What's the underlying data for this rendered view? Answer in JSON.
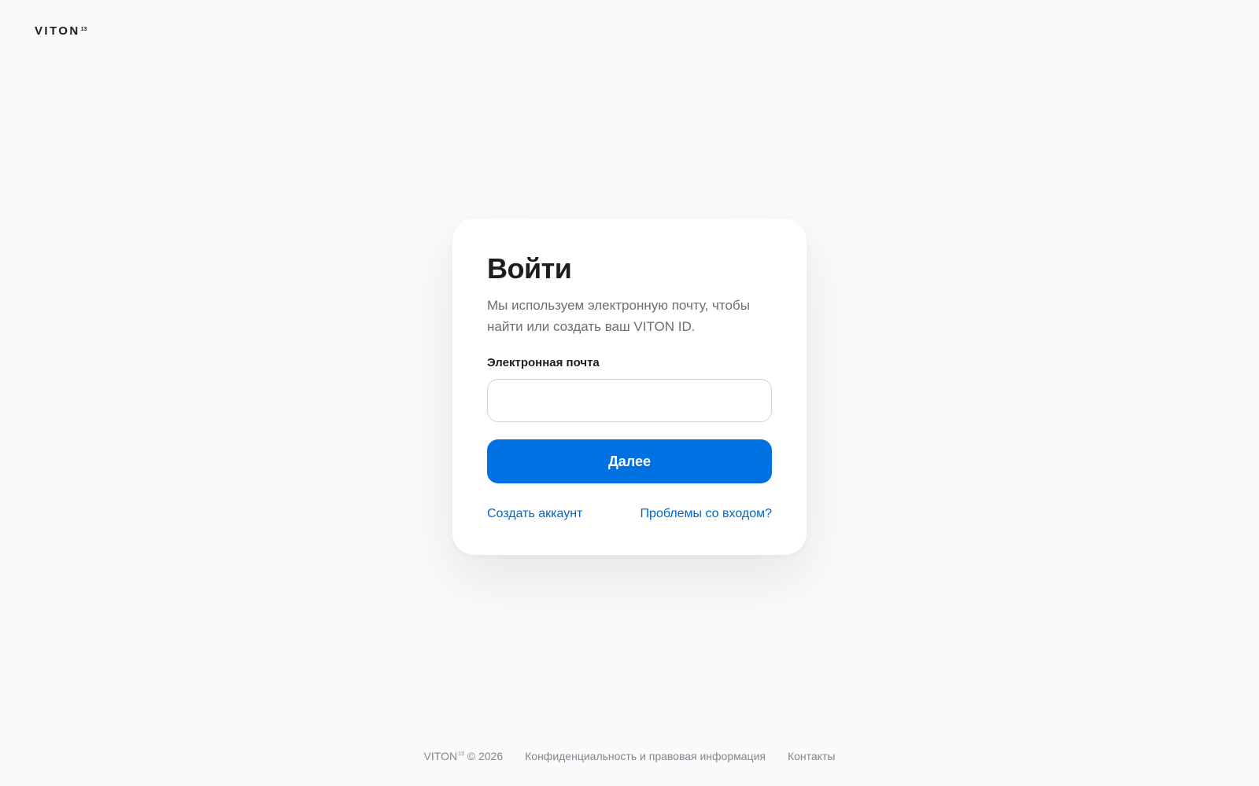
{
  "header": {
    "logo_text": "VITON",
    "logo_sup": "13"
  },
  "signin": {
    "title": "Войти",
    "subtitle": "Мы используем электронную почту, чтобы найти или создать ваш VITON ID.",
    "email_label": "Электронная почта",
    "email_value": "",
    "email_placeholder": "",
    "next_button": "Далее",
    "create_account_link": "Создать аккаунт",
    "trouble_link": "Проблемы со входом?"
  },
  "footer": {
    "brand": "VITON",
    "brand_sup": "13",
    "copyright": "© 2026",
    "privacy_link": "Конфиденциальность и правовая информация",
    "contacts_link": "Контакты"
  },
  "colors": {
    "background": "#fafafc",
    "card": "#ffffff",
    "accent": "#0071e3",
    "link": "#0066cc",
    "text_primary": "#1d1d1f",
    "text_secondary": "#6e6e73"
  }
}
